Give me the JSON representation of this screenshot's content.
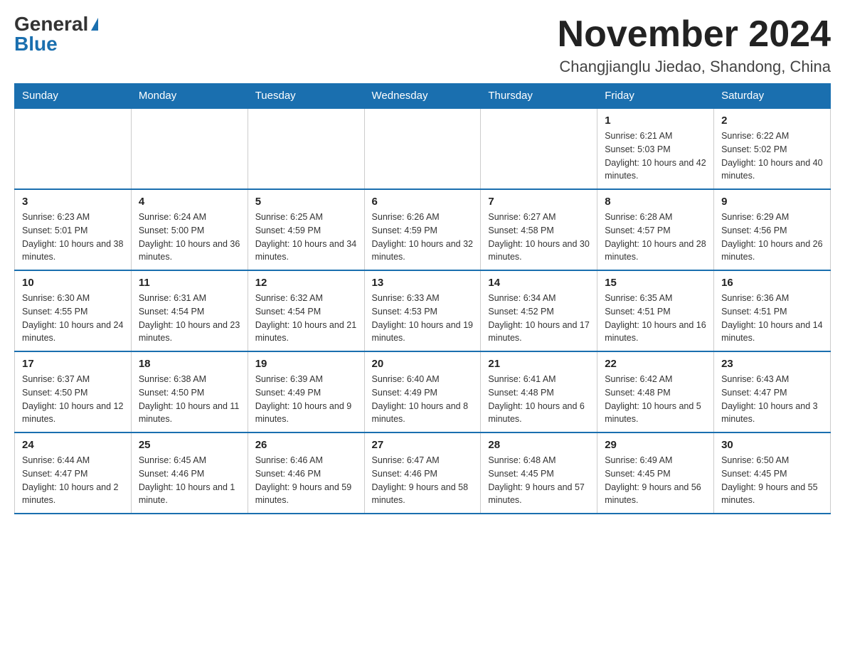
{
  "header": {
    "logo_general": "General",
    "logo_blue": "Blue",
    "month_title": "November 2024",
    "location": "Changjianglu Jiedao, Shandong, China"
  },
  "days_of_week": [
    "Sunday",
    "Monday",
    "Tuesday",
    "Wednesday",
    "Thursday",
    "Friday",
    "Saturday"
  ],
  "weeks": [
    [
      {
        "day": "",
        "info": ""
      },
      {
        "day": "",
        "info": ""
      },
      {
        "day": "",
        "info": ""
      },
      {
        "day": "",
        "info": ""
      },
      {
        "day": "",
        "info": ""
      },
      {
        "day": "1",
        "info": "Sunrise: 6:21 AM\nSunset: 5:03 PM\nDaylight: 10 hours and 42 minutes."
      },
      {
        "day": "2",
        "info": "Sunrise: 6:22 AM\nSunset: 5:02 PM\nDaylight: 10 hours and 40 minutes."
      }
    ],
    [
      {
        "day": "3",
        "info": "Sunrise: 6:23 AM\nSunset: 5:01 PM\nDaylight: 10 hours and 38 minutes."
      },
      {
        "day": "4",
        "info": "Sunrise: 6:24 AM\nSunset: 5:00 PM\nDaylight: 10 hours and 36 minutes."
      },
      {
        "day": "5",
        "info": "Sunrise: 6:25 AM\nSunset: 4:59 PM\nDaylight: 10 hours and 34 minutes."
      },
      {
        "day": "6",
        "info": "Sunrise: 6:26 AM\nSunset: 4:59 PM\nDaylight: 10 hours and 32 minutes."
      },
      {
        "day": "7",
        "info": "Sunrise: 6:27 AM\nSunset: 4:58 PM\nDaylight: 10 hours and 30 minutes."
      },
      {
        "day": "8",
        "info": "Sunrise: 6:28 AM\nSunset: 4:57 PM\nDaylight: 10 hours and 28 minutes."
      },
      {
        "day": "9",
        "info": "Sunrise: 6:29 AM\nSunset: 4:56 PM\nDaylight: 10 hours and 26 minutes."
      }
    ],
    [
      {
        "day": "10",
        "info": "Sunrise: 6:30 AM\nSunset: 4:55 PM\nDaylight: 10 hours and 24 minutes."
      },
      {
        "day": "11",
        "info": "Sunrise: 6:31 AM\nSunset: 4:54 PM\nDaylight: 10 hours and 23 minutes."
      },
      {
        "day": "12",
        "info": "Sunrise: 6:32 AM\nSunset: 4:54 PM\nDaylight: 10 hours and 21 minutes."
      },
      {
        "day": "13",
        "info": "Sunrise: 6:33 AM\nSunset: 4:53 PM\nDaylight: 10 hours and 19 minutes."
      },
      {
        "day": "14",
        "info": "Sunrise: 6:34 AM\nSunset: 4:52 PM\nDaylight: 10 hours and 17 minutes."
      },
      {
        "day": "15",
        "info": "Sunrise: 6:35 AM\nSunset: 4:51 PM\nDaylight: 10 hours and 16 minutes."
      },
      {
        "day": "16",
        "info": "Sunrise: 6:36 AM\nSunset: 4:51 PM\nDaylight: 10 hours and 14 minutes."
      }
    ],
    [
      {
        "day": "17",
        "info": "Sunrise: 6:37 AM\nSunset: 4:50 PM\nDaylight: 10 hours and 12 minutes."
      },
      {
        "day": "18",
        "info": "Sunrise: 6:38 AM\nSunset: 4:50 PM\nDaylight: 10 hours and 11 minutes."
      },
      {
        "day": "19",
        "info": "Sunrise: 6:39 AM\nSunset: 4:49 PM\nDaylight: 10 hours and 9 minutes."
      },
      {
        "day": "20",
        "info": "Sunrise: 6:40 AM\nSunset: 4:49 PM\nDaylight: 10 hours and 8 minutes."
      },
      {
        "day": "21",
        "info": "Sunrise: 6:41 AM\nSunset: 4:48 PM\nDaylight: 10 hours and 6 minutes."
      },
      {
        "day": "22",
        "info": "Sunrise: 6:42 AM\nSunset: 4:48 PM\nDaylight: 10 hours and 5 minutes."
      },
      {
        "day": "23",
        "info": "Sunrise: 6:43 AM\nSunset: 4:47 PM\nDaylight: 10 hours and 3 minutes."
      }
    ],
    [
      {
        "day": "24",
        "info": "Sunrise: 6:44 AM\nSunset: 4:47 PM\nDaylight: 10 hours and 2 minutes."
      },
      {
        "day": "25",
        "info": "Sunrise: 6:45 AM\nSunset: 4:46 PM\nDaylight: 10 hours and 1 minute."
      },
      {
        "day": "26",
        "info": "Sunrise: 6:46 AM\nSunset: 4:46 PM\nDaylight: 9 hours and 59 minutes."
      },
      {
        "day": "27",
        "info": "Sunrise: 6:47 AM\nSunset: 4:46 PM\nDaylight: 9 hours and 58 minutes."
      },
      {
        "day": "28",
        "info": "Sunrise: 6:48 AM\nSunset: 4:45 PM\nDaylight: 9 hours and 57 minutes."
      },
      {
        "day": "29",
        "info": "Sunrise: 6:49 AM\nSunset: 4:45 PM\nDaylight: 9 hours and 56 minutes."
      },
      {
        "day": "30",
        "info": "Sunrise: 6:50 AM\nSunset: 4:45 PM\nDaylight: 9 hours and 55 minutes."
      }
    ]
  ]
}
